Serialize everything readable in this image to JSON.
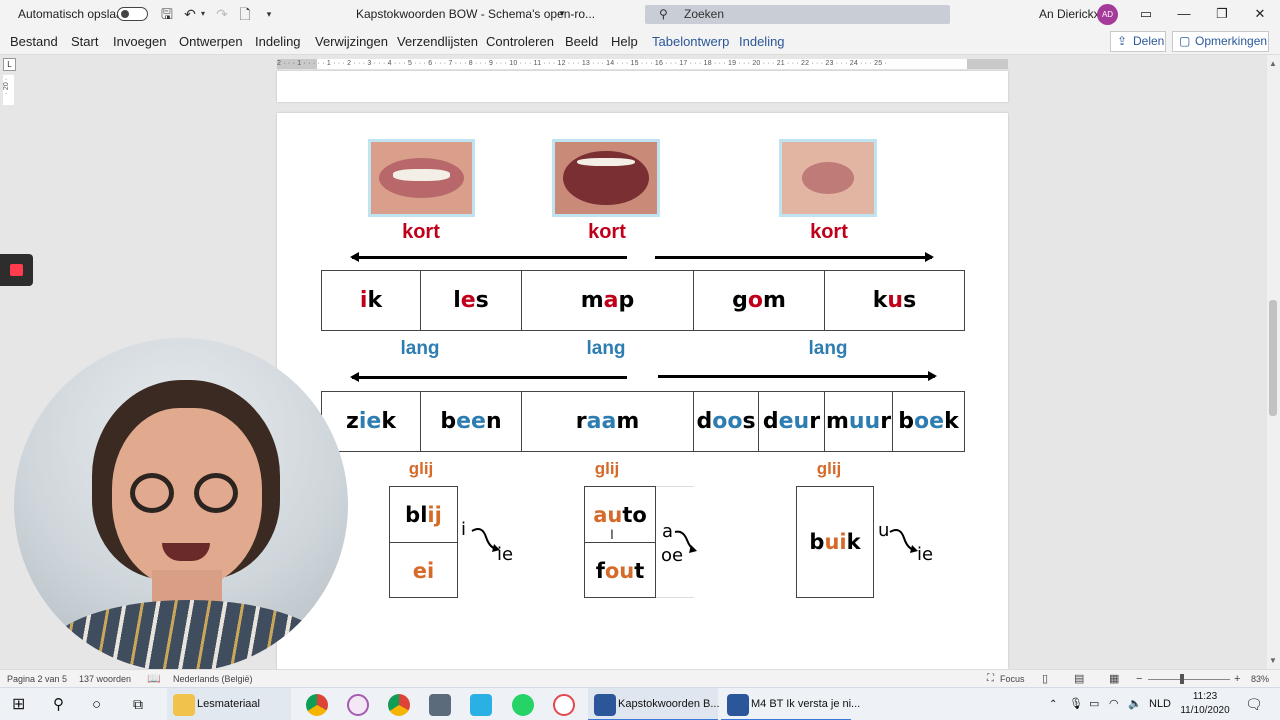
{
  "titlebar": {
    "autosave_label": "Automatisch opslaan",
    "doc_title": "Kapstokwoorden BOW - Schema's open-ro...",
    "search_placeholder": "Zoeken",
    "user_name": "An Dierickx",
    "user_initials": "AD"
  },
  "menu": {
    "items": [
      "Bestand",
      "Start",
      "Invoegen",
      "Ontwerpen",
      "Indeling",
      "Verwijzingen",
      "Verzendlijsten",
      "Controleren",
      "Beeld",
      "Help"
    ],
    "context_items": [
      "Tabelontwerp",
      "Indeling"
    ],
    "share_label": "Delen",
    "comments_label": "Opmerkingen"
  },
  "ruler": {
    "corner": "L",
    "numbers": "2 · · · 1 · · · · · 1 · · · 2 · · · 3 · · · 4 · · · 5 · · · 6 · · · 7 · · · 8 · · · 9 · · · 10 · · · 11 · · · 12 · · · 13 · · · 14 · · · 15 · · · 16 · · · 17 · · · 18 · · · 19 · · · 20 · · · 21 · · · 22 · · · 23 · · · 24 · · · 25 ·",
    "vertical": "· 20 ·"
  },
  "document": {
    "kort_label": "kort",
    "lang_label": "lang",
    "glij_label": "glij",
    "short_words": [
      {
        "parts": [
          {
            "t": "i",
            "c": "red"
          },
          {
            "t": "k",
            "c": ""
          }
        ]
      },
      {
        "parts": [
          {
            "t": "l",
            "c": ""
          },
          {
            "t": "e",
            "c": "red"
          },
          {
            "t": "s",
            "c": ""
          }
        ]
      },
      {
        "parts": [
          {
            "t": "m",
            "c": ""
          },
          {
            "t": "a",
            "c": "red"
          },
          {
            "t": "p",
            "c": ""
          }
        ]
      },
      {
        "parts": [
          {
            "t": "g",
            "c": ""
          },
          {
            "t": "o",
            "c": "red"
          },
          {
            "t": "m",
            "c": ""
          }
        ]
      },
      {
        "parts": [
          {
            "t": "k",
            "c": ""
          },
          {
            "t": "u",
            "c": "red"
          },
          {
            "t": "s",
            "c": ""
          }
        ]
      }
    ],
    "long_words": [
      {
        "parts": [
          {
            "t": "z",
            "c": ""
          },
          {
            "t": "ie",
            "c": "blue"
          },
          {
            "t": "k",
            "c": ""
          }
        ]
      },
      {
        "parts": [
          {
            "t": "b",
            "c": ""
          },
          {
            "t": "ee",
            "c": "blue"
          },
          {
            "t": "n",
            "c": ""
          }
        ]
      },
      {
        "parts": [
          {
            "t": "r",
            "c": ""
          },
          {
            "t": "aa",
            "c": "blue"
          },
          {
            "t": "m",
            "c": ""
          }
        ]
      },
      {
        "parts": [
          {
            "t": "d",
            "c": ""
          },
          {
            "t": "oo",
            "c": "blue"
          },
          {
            "t": "s",
            "c": ""
          }
        ]
      },
      {
        "parts": [
          {
            "t": "d",
            "c": ""
          },
          {
            "t": "eu",
            "c": "blue"
          },
          {
            "t": "r",
            "c": ""
          }
        ]
      },
      {
        "parts": [
          {
            "t": "m",
            "c": ""
          },
          {
            "t": "uu",
            "c": "blue"
          },
          {
            "t": "r",
            "c": ""
          }
        ]
      },
      {
        "parts": [
          {
            "t": "b",
            "c": ""
          },
          {
            "t": "oe",
            "c": "blue"
          },
          {
            "t": "k",
            "c": ""
          }
        ]
      }
    ],
    "glide_1": {
      "top": [
        {
          "t": "bl",
          "c": ""
        },
        {
          "t": "ij",
          "c": "orange"
        }
      ],
      "bottom": [
        {
          "t": "ei",
          "c": "orange"
        }
      ],
      "note_from": "i",
      "note_to": "ie"
    },
    "glide_2": {
      "top": [
        {
          "t": "au",
          "c": "orange"
        },
        {
          "t": "to",
          "c": ""
        }
      ],
      "bottom": [
        {
          "t": "f",
          "c": ""
        },
        {
          "t": "ou",
          "c": "orange"
        },
        {
          "t": "t",
          "c": ""
        }
      ],
      "note_from": "a",
      "note_to": "oe"
    },
    "glide_3": {
      "top": [
        {
          "t": "b",
          "c": ""
        },
        {
          "t": "ui",
          "c": "orange"
        },
        {
          "t": "k",
          "c": ""
        }
      ],
      "note_from": "u",
      "note_to": "ie"
    }
  },
  "statusbar": {
    "page": "Pagina 2 van 5",
    "words": "137 woorden",
    "language": "Nederlands (België)",
    "focus": "Focus",
    "zoom": "83%"
  },
  "taskbar": {
    "folder_label": "Lesmateriaal",
    "word1_label": "Kapstokwoorden B...",
    "word2_label": "M4 BT Ik versta je ni...",
    "lang": "NLD",
    "time": "11:23",
    "date": "11/10/2020"
  }
}
